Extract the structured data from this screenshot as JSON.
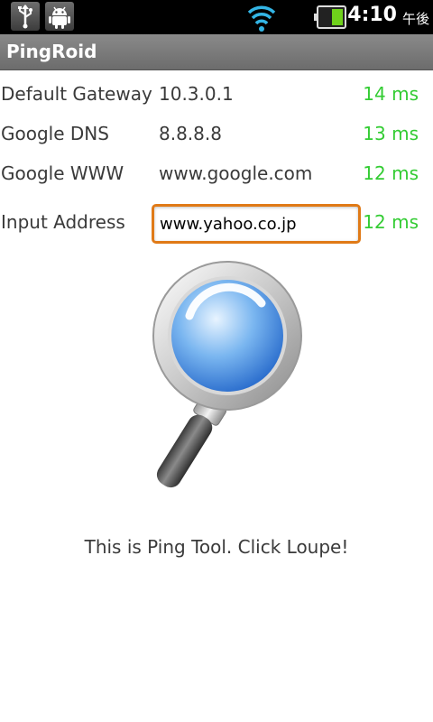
{
  "status_bar": {
    "time": "4:10",
    "ampm": "午後",
    "icons": [
      "usb-icon",
      "android-debug-icon",
      "wifi-icon",
      "battery-icon"
    ]
  },
  "app": {
    "title": "PingRoid"
  },
  "rows": [
    {
      "label": "Default Gateway",
      "value": "10.3.0.1",
      "time": "14 ms"
    },
    {
      "label": "Google DNS",
      "value": "8.8.8.8",
      "time": "13 ms"
    },
    {
      "label": "Google WWW",
      "value": "www.google.com",
      "time": "12 ms"
    }
  ],
  "input_row": {
    "label": "Input Address",
    "value": "www.yahoo.co.jp",
    "time": "12 ms"
  },
  "caption": "This is Ping Tool. Click Loupe!",
  "colors": {
    "ms_green": "#33cc33",
    "focus_orange": "#e07a17",
    "title_bar": "#7a7a7a"
  }
}
